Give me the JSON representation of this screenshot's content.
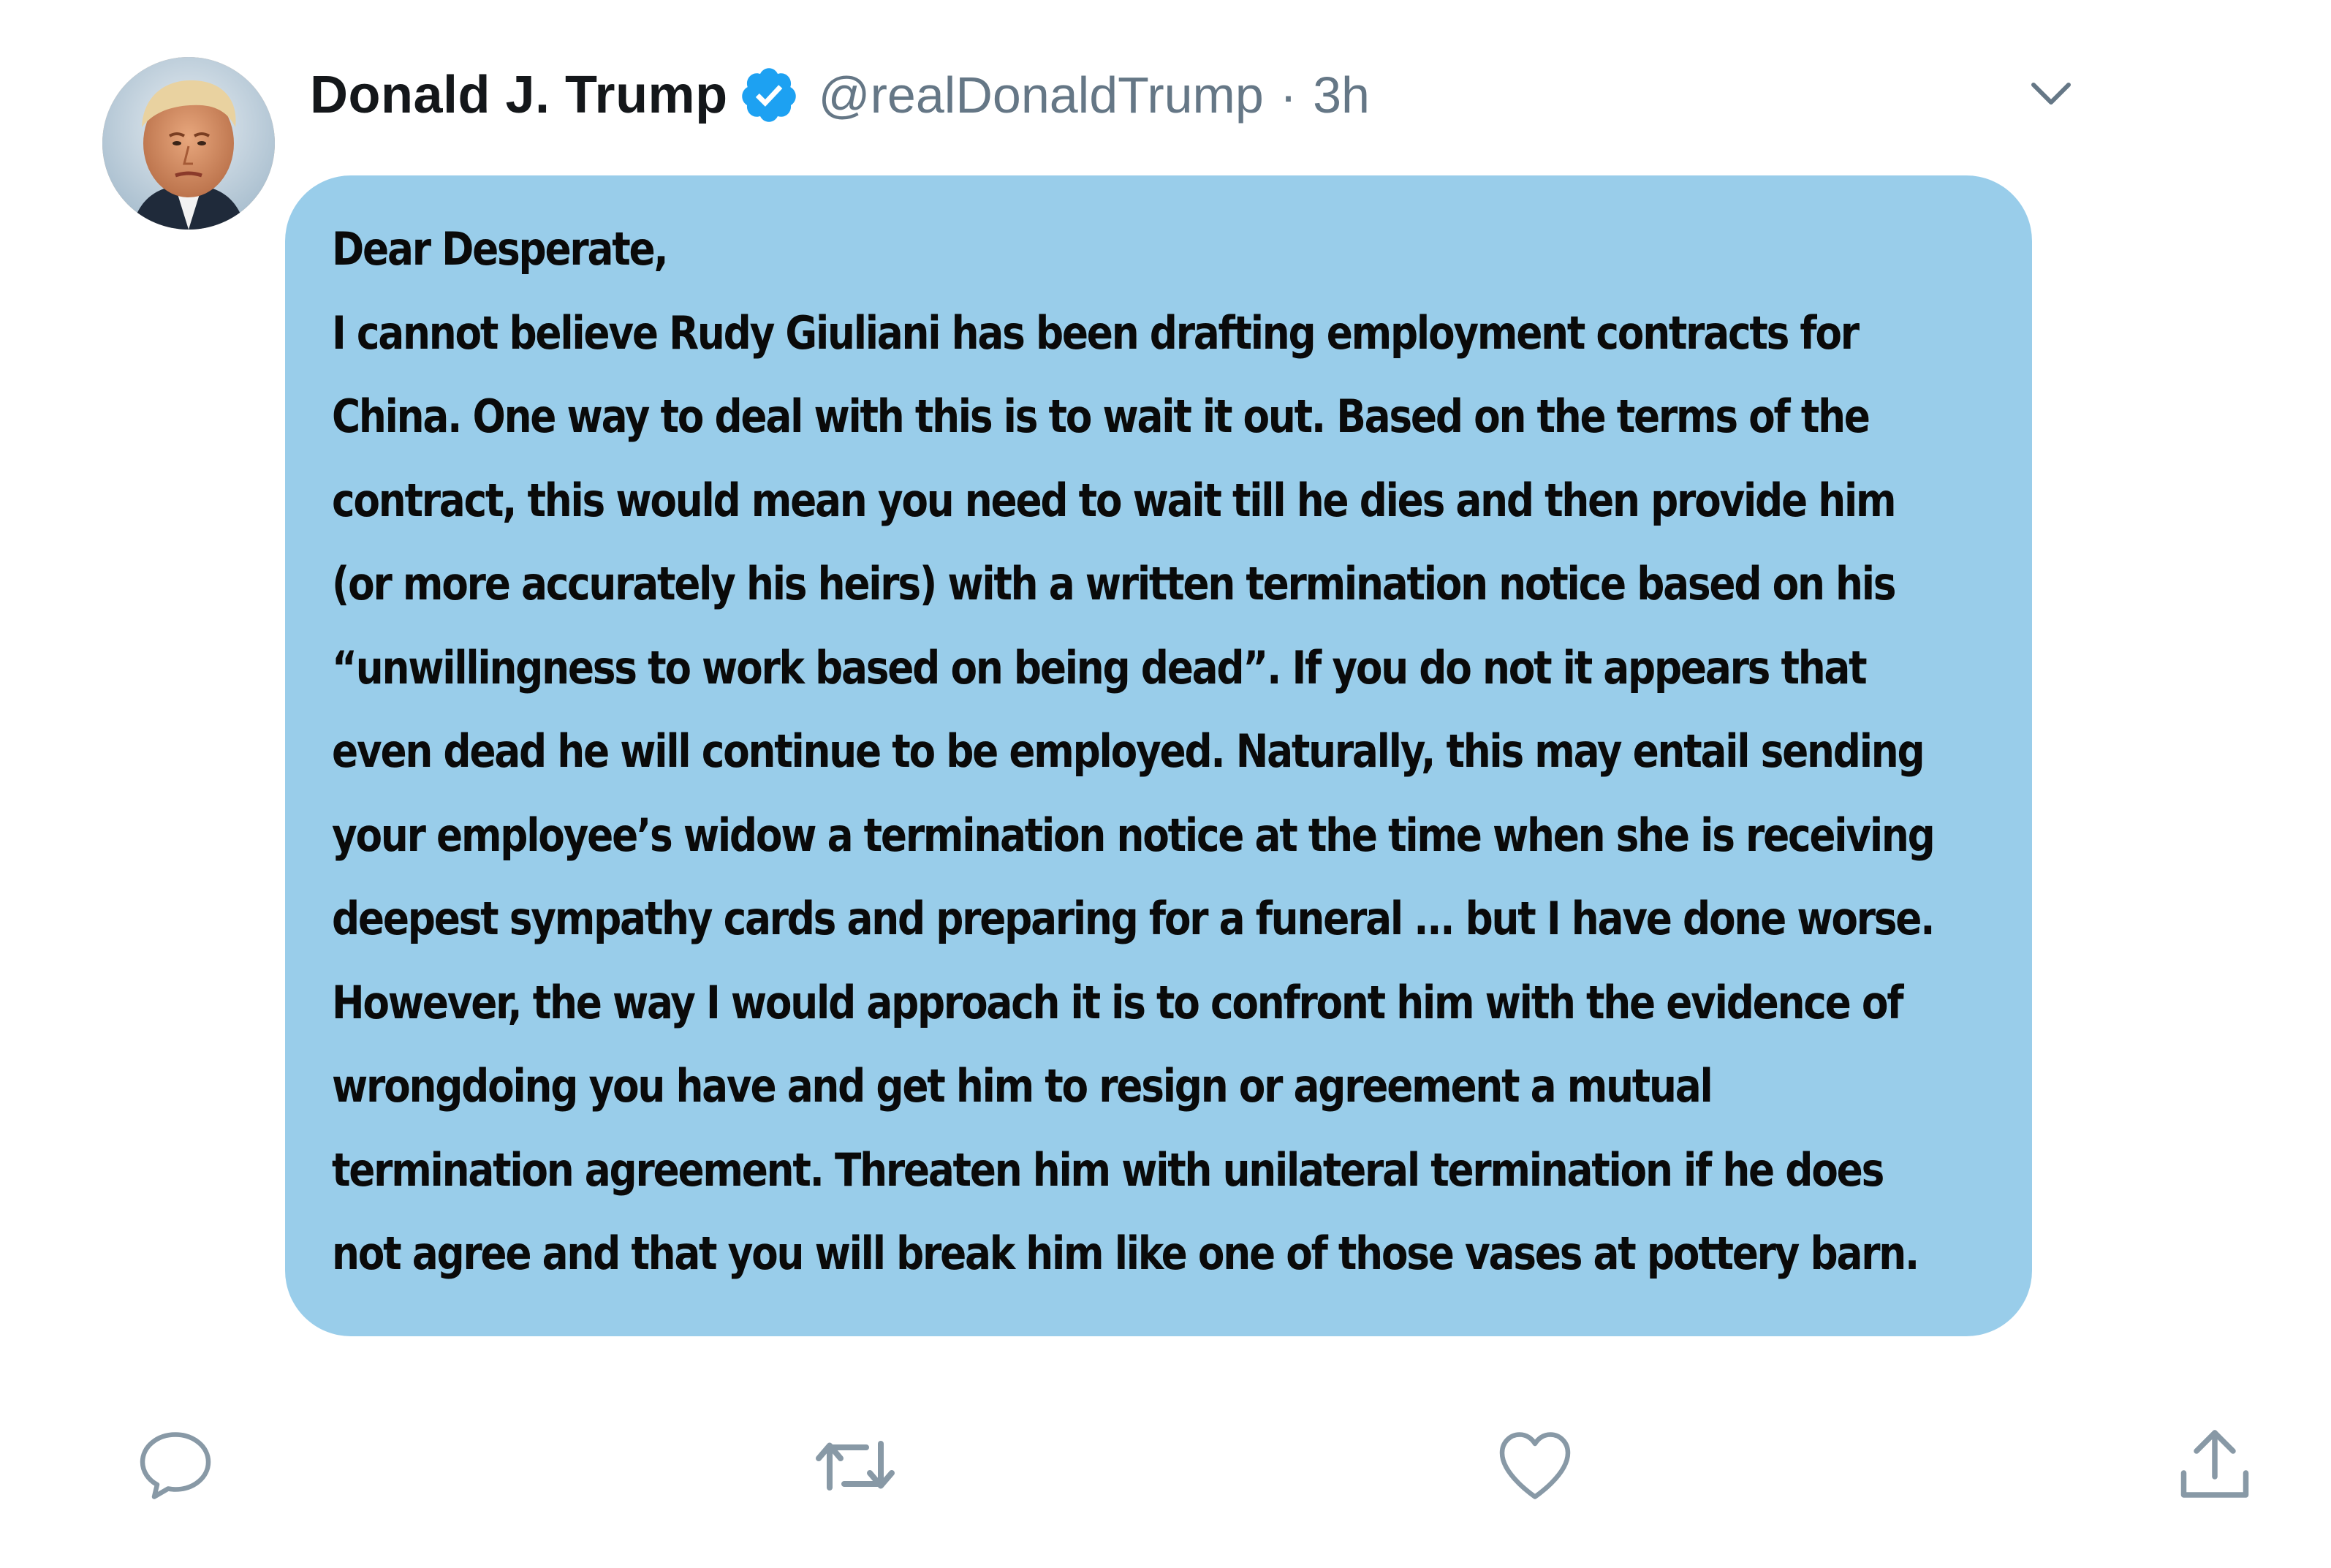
{
  "tweet": {
    "display_name": "Donald J. Trump",
    "handle": "@realDonaldTrump",
    "separator": "·",
    "timestamp": "3h",
    "verified": true,
    "body_lines": [
      "Dear Desperate,",
      "I cannot believe Rudy Giuliani has been drafting employment contracts for",
      "China. One way to deal with this is to wait it out. Based on the terms of the",
      "contract, this would mean you need to wait till he dies and then provide him",
      "(or more accurately his heirs) with a written termination notice based on his",
      "“unwillingness to work based on being dead”. If you do not it appears that",
      "even dead he will continue to be employed. Naturally, this may entail sending",
      "your employee’s widow a termination notice at the time when she is receiving",
      "deepest sympathy cards and preparing for a funeral ... but I have done worse.",
      "However, the way I would approach it is to confront him with the evidence of",
      "wrongdoing you have and get him to resign or agreement a mutual",
      "termination agreement. Threaten him with unilateral termination if he does",
      "not agree and that you will break him like one of those vases at pottery barn."
    ]
  },
  "icons": {
    "avatar": "avatar-portrait",
    "verified": "verified-badge-icon",
    "caret": "chevron-down-icon",
    "reply": "reply-bubble-icon",
    "retweet": "retweet-icon",
    "like": "heart-icon",
    "share": "share-upload-icon"
  },
  "colors": {
    "note_background": "#99cdea",
    "verified_blue": "#1da1f2",
    "secondary_text": "#657786",
    "icon_gray": "#8899a6"
  }
}
